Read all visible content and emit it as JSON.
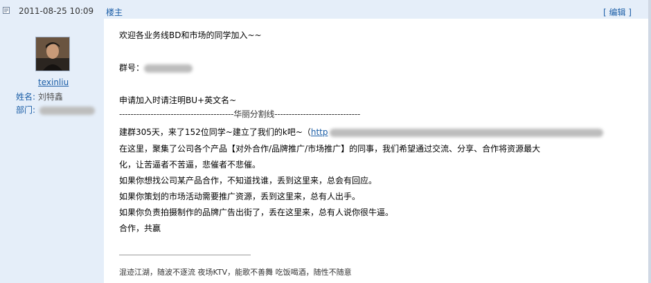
{
  "header": {
    "date": "2011-08-25 10:09",
    "floor": "楼主",
    "edit": "[ 编辑 ]"
  },
  "author": {
    "username": "texinliu",
    "name_label": "姓名:",
    "name_value": "刘特鑫",
    "dept_label": "部门:"
  },
  "post": {
    "line1": "欢迎各业务线BD和市场的同学加入~~",
    "group_label": "群号：",
    "apply": "申请加入时请注明BU+英文名~",
    "divider": "----------------------------------------华丽分割线------------------------------",
    "line_group_prefix": "建群305天，来了152位同学~建立了我们的k吧~（",
    "line_group_link": "http",
    "p1a": "在这里，聚集了公司各个产品【对外合作/品牌推广/市场推广】的同事，我们希望通过交流、分享、合作将资源最大",
    "p1b": "化，让苦逼者不苦逼，悲催者不悲催。",
    "p2": "如果你想找公司某产品合作，不知道找谁，丢到这里来，总会有回应。",
    "p3": "如果你策划的市场活动需要推广资源，丢到这里来，总有人出手。",
    "p4": "如果你负责拍摄制作的品牌广告出街了，丢在这里来，总有人说你很牛逼。",
    "p5": "合作，共赢"
  },
  "signature": "混迹江湖，随波不逐流 夜场KTV，能歌不善舞 吃饭喝酒，随性不随意"
}
